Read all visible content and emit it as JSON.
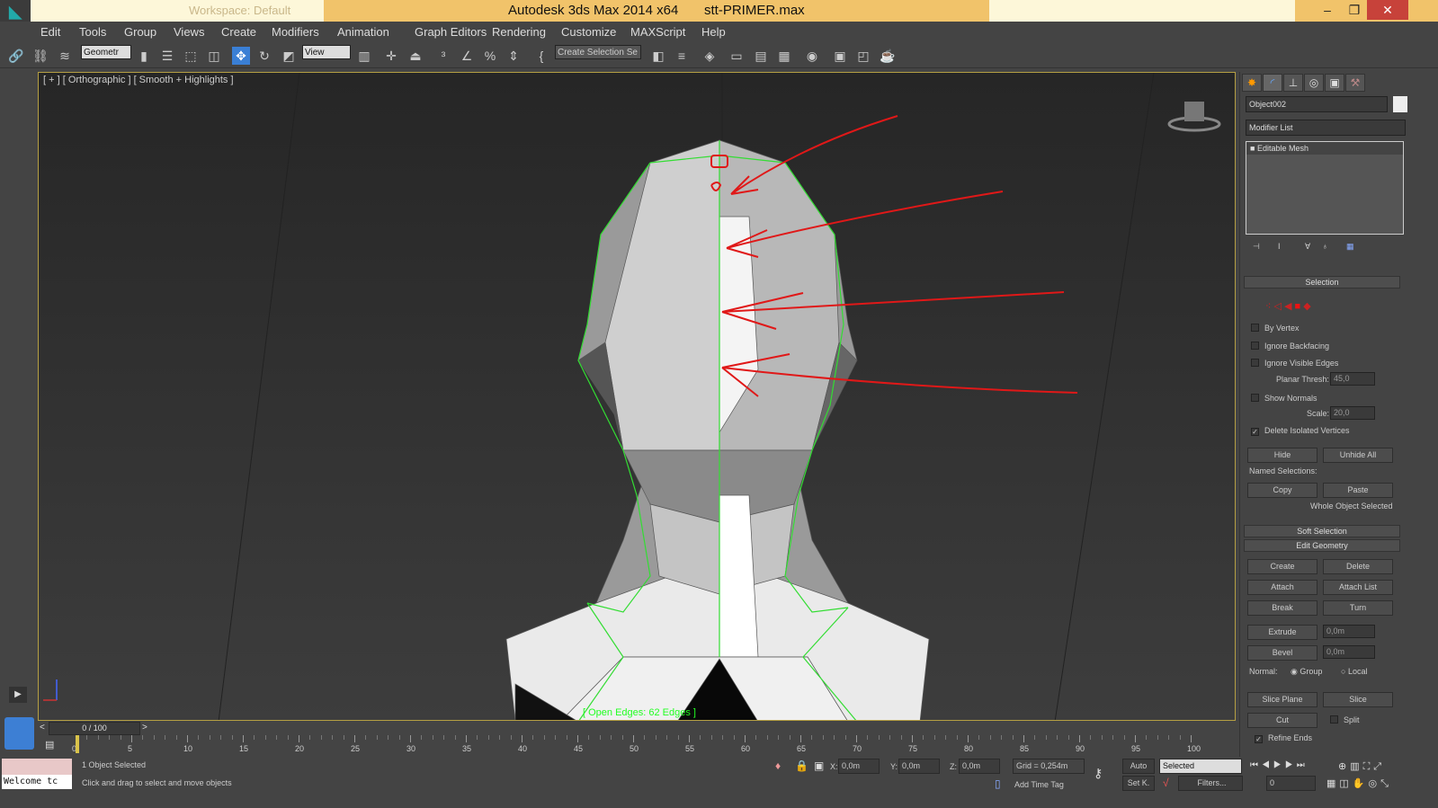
{
  "titlebar": {
    "workspace": "Workspace: Default",
    "app_title": "Autodesk 3ds Max  2014 x64",
    "filename": "stt-PRIMER.max"
  },
  "menu": [
    "Edit",
    "Tools",
    "Group",
    "Views",
    "Create",
    "Modifiers",
    "Animation",
    "Graph Editors",
    "Rendering",
    "Customize",
    "MAXScript",
    "Help"
  ],
  "toolbar": {
    "selection_filter": "Geometr",
    "ref_coord": "View",
    "named_selection_placeholder": "Create Selection Se"
  },
  "viewport": {
    "label": "[ + ] [ Orthographic ] [ Smooth + Highlights ]",
    "open_edges": "[ Open Edges: 62 Edges ]",
    "wire_color": "#33dd33",
    "annotation_color": "#e01818"
  },
  "command_panel": {
    "object_name": "Object002",
    "modifier_list": "Modifier List",
    "stack_item": "Editable Mesh",
    "selection": {
      "title": "Selection",
      "by_vertex": "By Vertex",
      "ignore_backfacing": "Ignore Backfacing",
      "ignore_visible_edges": "Ignore Visible Edges",
      "planar_thresh_label": "Planar Thresh:",
      "planar_thresh": "45,0",
      "show_normals": "Show Normals",
      "scale_label": "Scale:",
      "scale": "20,0",
      "delete_isolated": "Delete Isolated Vertices",
      "delete_isolated_checked": true,
      "hide": "Hide",
      "unhide_all": "Unhide All",
      "named_selections": "Named Selections:",
      "copy": "Copy",
      "paste": "Paste",
      "status": "Whole Object Selected"
    },
    "soft_selection": "Soft Selection",
    "edit_geometry": {
      "title": "Edit Geometry",
      "create": "Create",
      "delete": "Delete",
      "attach": "Attach",
      "attach_list": "Attach List",
      "break": "Break",
      "turn": "Turn",
      "extrude": "Extrude",
      "extrude_value": "0,0m",
      "bevel": "Bevel",
      "bevel_value": "0,0m",
      "normal_label": "Normal:",
      "group": "Group",
      "local": "Local",
      "slice_plane": "Slice Plane",
      "slice": "Slice",
      "cut": "Cut",
      "split": "Split",
      "refine_ends": "Refine Ends",
      "refine_ends_checked": true
    }
  },
  "timeline": {
    "frame": "0 / 100",
    "ticks": [
      "0",
      "5",
      "10",
      "15",
      "20",
      "25",
      "30",
      "35",
      "40",
      "45",
      "50",
      "55",
      "60",
      "65",
      "70",
      "75",
      "80",
      "85",
      "90",
      "95",
      "100"
    ]
  },
  "status": {
    "selected": "1 Object Selected",
    "prompt": "Click and drag to select and move objects",
    "welcome": "Welcome tc",
    "x_label": "X:",
    "x": "0,0m",
    "y_label": "Y:",
    "y": "0,0m",
    "z_label": "Z:",
    "z": "0,0m",
    "grid": "Grid = 0,254m",
    "add_time_tag": "Add Time Tag",
    "auto": "Auto",
    "set_key": "Set K.",
    "key_filter": "Selected",
    "filters": "Filters...",
    "current_frame": "0"
  }
}
